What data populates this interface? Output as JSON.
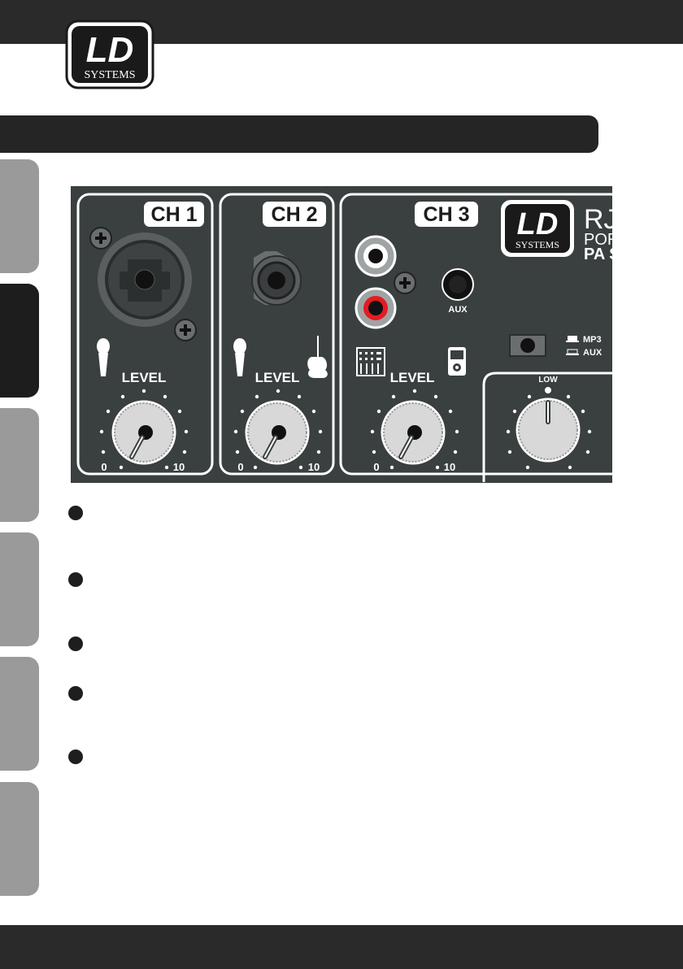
{
  "brand": {
    "logo_main": "LD",
    "logo_sub": "SYSTEMS"
  },
  "panel": {
    "channels": [
      {
        "label": "CH 1",
        "level_label": "LEVEL",
        "min_label": "0",
        "max_label": "10"
      },
      {
        "label": "CH 2",
        "level_label": "LEVEL",
        "min_label": "0",
        "max_label": "10"
      },
      {
        "label": "CH 3",
        "level_label": "LEVEL",
        "min_label": "0",
        "max_label": "10"
      }
    ],
    "aux_label": "AUX",
    "switch_options": [
      "MP3",
      "AUX"
    ],
    "eq_knob_label": "LOW",
    "model_text": {
      "line1": "RJ",
      "line2": "POR",
      "line3": "PA S"
    },
    "panel_logo_main": "LD",
    "panel_logo_sub": "SYSTEMS",
    "colors": {
      "panel_bg": "#3a3f40",
      "rca_red": "#e31b23"
    }
  },
  "bullets": [
    "",
    "",
    "",
    "",
    ""
  ]
}
